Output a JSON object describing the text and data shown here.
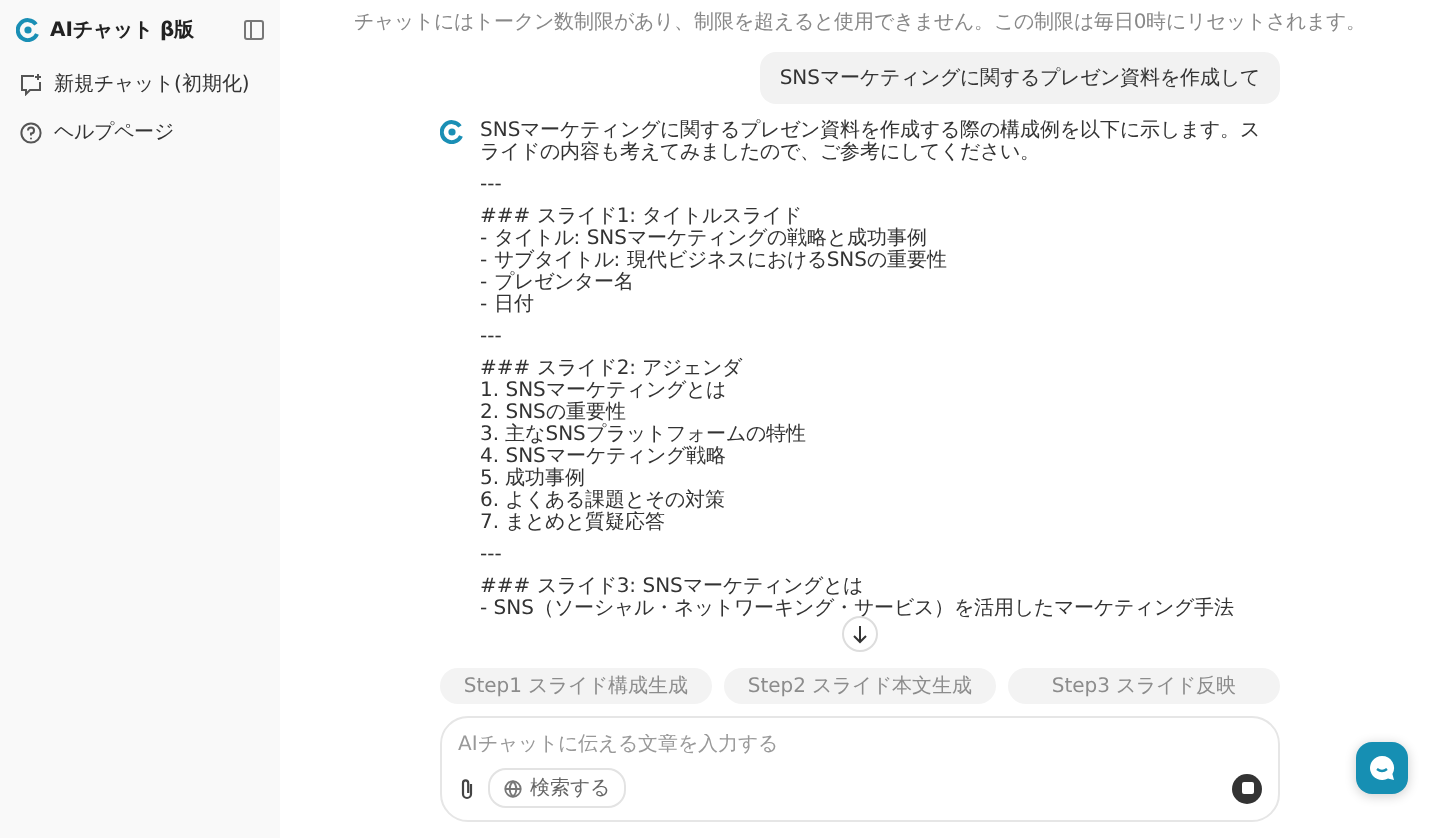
{
  "sidebar": {
    "brand": "AIチャット β版",
    "items": [
      {
        "kind": "new-chat",
        "label": "新規チャット(初期化)"
      },
      {
        "kind": "help",
        "label": "ヘルプページ"
      }
    ]
  },
  "notice": "チャットにはトークン数制限があり、制限を超えると使用できません。この制限は毎日0時にリセットされます。",
  "user_message": "SNSマーケティングに関するプレゼン資料を作成して",
  "assistant_message": {
    "blocks": [
      [
        "SNSマーケティングに関するプレゼン資料を作成する際の構成例を以下に示します。スライドの内容も考えてみましたので、ご参考にしてください。"
      ],
      [
        "---"
      ],
      [
        "### スライド1: タイトルスライド",
        "- タイトル: SNSマーケティングの戦略と成功事例",
        "- サブタイトル: 現代ビジネスにおけるSNSの重要性",
        "- プレゼンター名",
        "- 日付"
      ],
      [
        "---"
      ],
      [
        "### スライド2: アジェンダ",
        "1. SNSマーケティングとは",
        "2. SNSの重要性",
        "3. 主なSNSプラットフォームの特性",
        "4. SNSマーケティング戦略",
        "5. 成功事例",
        "6. よくある課題とその対策",
        "7. まとめと質疑応答"
      ],
      [
        "---"
      ],
      [
        "### スライド3: SNSマーケティングとは",
        "- SNS（ソーシャル・ネットワーキング・サービス）を活用したマーケティング手法"
      ]
    ]
  },
  "steps": [
    {
      "label": "Step1 スライド構成生成",
      "disabled": true
    },
    {
      "label": "Step2 スライド本文生成",
      "disabled": true
    },
    {
      "label": "Step3 スライド反映",
      "disabled": true
    }
  ],
  "composer": {
    "placeholder": "AIチャットに伝える文章を入力する",
    "search_label": "検索する"
  }
}
